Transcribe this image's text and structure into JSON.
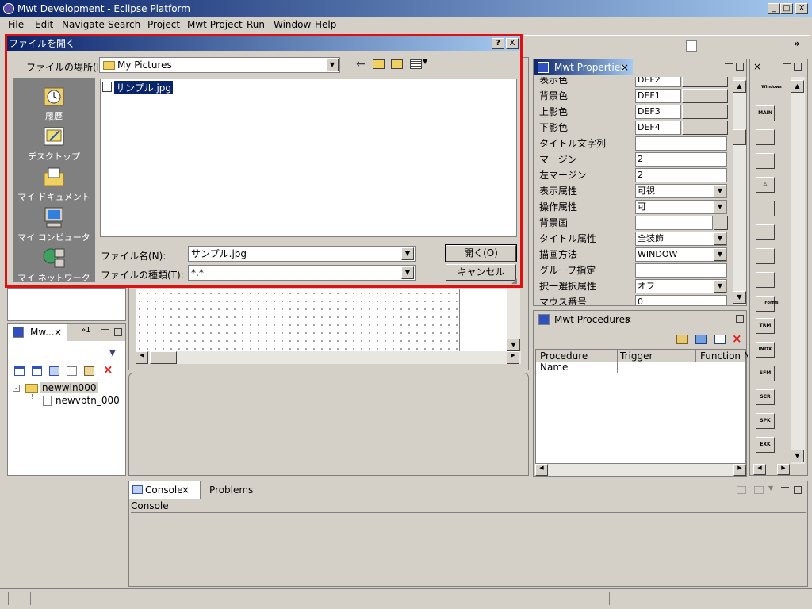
{
  "window": {
    "title": "Mwt Development - Eclipse Platform",
    "min": "_",
    "max": "□",
    "close": "X"
  },
  "menu": [
    "File",
    "Edit",
    "Navigate",
    "Search",
    "Project",
    "Mwt Project",
    "Run",
    "Window",
    "Help"
  ],
  "properties": {
    "tab": "Mwt Properties",
    "rows": [
      {
        "label": "表示色",
        "value": "DEF2",
        "type": "color"
      },
      {
        "label": "背景色",
        "value": "DEF1",
        "type": "color"
      },
      {
        "label": "上影色",
        "value": "DEF3",
        "type": "color"
      },
      {
        "label": "下影色",
        "value": "DEF4",
        "type": "color"
      },
      {
        "label": "タイトル文字列",
        "value": "",
        "type": "text"
      },
      {
        "label": "マージン",
        "value": "2",
        "type": "text"
      },
      {
        "label": "左マージン",
        "value": "2",
        "type": "text"
      },
      {
        "label": "表示属性",
        "value": "可視",
        "type": "combo"
      },
      {
        "label": "操作属性",
        "value": "可",
        "type": "combo"
      },
      {
        "label": "背景画",
        "value": "",
        "type": "browse"
      },
      {
        "label": "タイトル属性",
        "value": "全装飾",
        "type": "combo"
      },
      {
        "label": "描画方法",
        "value": "WINDOW",
        "type": "combo"
      },
      {
        "label": "グループ指定",
        "value": "",
        "type": "text"
      },
      {
        "label": "択一選択属性",
        "value": "オフ",
        "type": "combo"
      },
      {
        "label": "マウス番号",
        "value": "0",
        "type": "text"
      }
    ]
  },
  "palette": {
    "header1": "Windows",
    "header2": "Forms",
    "buttons1": [
      "MAIN",
      "",
      "",
      "⚠",
      "",
      "",
      "",
      "",
      ""
    ],
    "buttons2": [
      "TRM",
      "INDX",
      "SFM",
      "SCR",
      "SPK",
      "EXK"
    ]
  },
  "procedures": {
    "tab": "Mwt Procedures",
    "columns": [
      "Procedure Name",
      "Trigger",
      "Function Na"
    ]
  },
  "navigator": {
    "tab": "Mw...",
    "overflow": "»1",
    "tree": {
      "root": "newwin000",
      "child": "newvbtn_000"
    }
  },
  "console": {
    "tabs": [
      "Console",
      "Problems"
    ],
    "label": "Console"
  },
  "dialog": {
    "title": "ファイルを開く",
    "help": "?",
    "close": "X",
    "lookin_label": "ファイルの場所(I):",
    "lookin_value": "My Pictures",
    "places": [
      "履歴",
      "デスクトップ",
      "マイ ドキュメント",
      "マイ コンピュータ",
      "マイ ネットワーク"
    ],
    "file": "サンプル.jpg",
    "filename_label": "ファイル名(N):",
    "filename_value": "サンプル.jpg",
    "filetype_label": "ファイルの種類(T):",
    "filetype_value": "*.*",
    "open_label": "開く(O)",
    "cancel_label": "キャンセル"
  },
  "colors": {
    "title_start": "#0a246a",
    "title_end": "#a6caf0",
    "highlight": "#e01010",
    "face": "#d4d0c8"
  }
}
